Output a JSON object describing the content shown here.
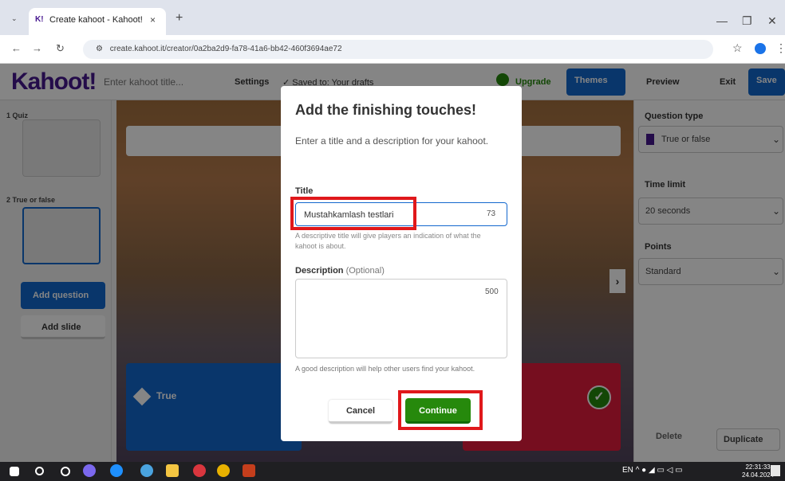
{
  "browser": {
    "tab_title": "Create kahoot - Kahoot!",
    "tab_logo": "K!",
    "tab_close": "×",
    "new_tab": "+",
    "tab_menu": "⌄",
    "url": "create.kahoot.it/creator/0a2ba2d9-fa78-41a6-bb42-460f3694ae72",
    "back": "←",
    "forward": "→",
    "reload": "↻",
    "site_info": "⚙",
    "bookmark": "☆",
    "menu": "⋮",
    "minimize": "—",
    "restore": "❐",
    "close": "✕"
  },
  "app": {
    "logo": "Kahoot!",
    "title_placeholder": "Enter kahoot title...",
    "settings": "Settings",
    "saved": "✓ Saved to: Your drafts",
    "upgrade": "Upgrade",
    "themes": "Themes",
    "preview": "Preview",
    "exit": "Exit",
    "save": "Save"
  },
  "left_panel": {
    "slides": [
      {
        "label": "1 Quiz"
      },
      {
        "label": "2 True or false"
      }
    ],
    "add_question": "Add question",
    "add_slide": "Add slide"
  },
  "canvas": {
    "answer_true": "True"
  },
  "right_panel": {
    "question_type_label": "Question type",
    "question_type_value": "True or false",
    "time_limit_label": "Time limit",
    "time_limit_value": "20 seconds",
    "points_label": "Points",
    "points_value": "Standard",
    "delete": "Delete",
    "duplicate": "Duplicate"
  },
  "modal": {
    "title": "Add the finishing touches!",
    "subtitle": "Enter a title and a description for your kahoot.",
    "title_label": "Title",
    "title_value": "Mustahkamlash testlari",
    "title_count": "73",
    "title_help": "A descriptive title will give players an indication of what the kahoot is about.",
    "description_label": "Description",
    "description_optional": "(Optional)",
    "description_count": "500",
    "description_help": "A good description will help other users find your kahoot.",
    "cancel": "Cancel",
    "continue": "Continue"
  },
  "taskbar": {
    "language": "EN",
    "time": "22:31:33",
    "date": "24.04.2024"
  },
  "colors": {
    "kahoot_purple": "#46178f",
    "kahoot_blue": "#1368ce",
    "kahoot_green": "#26890c",
    "kahoot_red": "#e21b3c",
    "highlight_red": "#e0181b"
  }
}
